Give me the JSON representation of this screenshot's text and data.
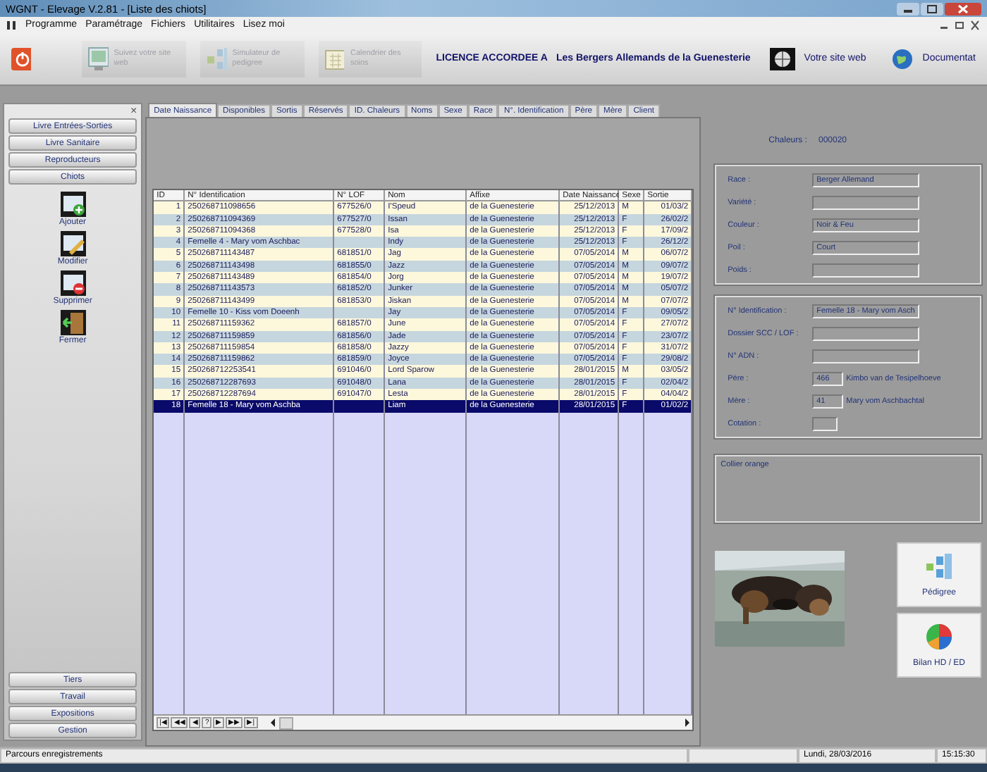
{
  "window": {
    "title": "WGNT - Elevage V.2.81 - [Liste des chiots]"
  },
  "menu": [
    "Programme",
    "Paramétrage",
    "Fichiers",
    "Utilitaires",
    "Lisez moi"
  ],
  "toolbar": {
    "buttons": [
      {
        "kind": "power"
      },
      {
        "kind": "web",
        "label": "Suivez votre site web",
        "disabled": true
      },
      {
        "kind": "pedigree",
        "label": "Simulateur de pedigree",
        "disabled": true
      },
      {
        "kind": "calendar",
        "label": "Calendrier des soins",
        "disabled": true
      }
    ],
    "licence": {
      "label": "LICENCE ACCORDEE A",
      "holder": "Les Bergers Allemands de la Guenesterie"
    },
    "links": [
      {
        "kind": "site",
        "label": "Votre site web"
      },
      {
        "kind": "doc",
        "label": "Documentat"
      }
    ]
  },
  "sidebar": {
    "close": "×",
    "top_sections": [
      "Livre Entrées-Sorties",
      "Livre Sanitaire",
      "Reproducteurs",
      "Chiots"
    ],
    "actions": [
      {
        "kind": "add",
        "label": "Ajouter"
      },
      {
        "kind": "edit",
        "label": "Modifier"
      },
      {
        "kind": "delete",
        "label": "Supprimer"
      },
      {
        "kind": "close",
        "label": "Fermer"
      }
    ],
    "bottom_sections": [
      "Tiers",
      "Travail",
      "Expositions",
      "Gestion"
    ]
  },
  "tabs": [
    {
      "label": "Date Naissance",
      "selected": true
    },
    {
      "label": "Disponibles",
      "selected": false
    },
    {
      "label": "Sortis",
      "selected": false
    },
    {
      "label": "Réservés",
      "selected": false
    },
    {
      "label": "ID. Chaleurs",
      "selected": false
    },
    {
      "label": "Noms",
      "selected": false
    },
    {
      "label": "Sexe",
      "selected": false
    },
    {
      "label": "Race",
      "selected": false
    },
    {
      "label": "N°. Identification",
      "selected": false
    },
    {
      "label": "Père",
      "selected": false
    },
    {
      "label": "Mère",
      "selected": false
    },
    {
      "label": "Client",
      "selected": false
    }
  ],
  "table": {
    "columns": [
      "ID",
      "N° Identification",
      "N° LOF",
      "Nom",
      "Affixe",
      "Date Naissance",
      "Sexe",
      "Sortie"
    ],
    "rows": [
      {
        "cells": [
          "1",
          "250268711098656",
          "677526/0",
          "I'Speud",
          "de la Guenesterie",
          "25/12/2013",
          "M",
          "01/03/2"
        ],
        "selected": false
      },
      {
        "cells": [
          "2",
          "250268711094369",
          "677527/0",
          "Issan",
          "de la Guenesterie",
          "25/12/2013",
          "F",
          "26/02/2"
        ],
        "selected": false
      },
      {
        "cells": [
          "3",
          "250268711094368",
          "677528/0",
          "Isa",
          "de la Guenesterie",
          "25/12/2013",
          "F",
          "17/09/2"
        ],
        "selected": false
      },
      {
        "cells": [
          "4",
          "Femelle 4 - Mary vom Aschbac",
          "",
          "Indy",
          "de la Guenesterie",
          "25/12/2013",
          "F",
          "26/12/2"
        ],
        "selected": false
      },
      {
        "cells": [
          "5",
          "250268711143487",
          "681851/0",
          "Jag",
          "de la Guenesterie",
          "07/05/2014",
          "M",
          "06/07/2"
        ],
        "selected": false
      },
      {
        "cells": [
          "6",
          "250268711143498",
          "681855/0",
          "Jazz",
          "de la Guenesterie",
          "07/05/2014",
          "M",
          "09/07/2"
        ],
        "selected": false
      },
      {
        "cells": [
          "7",
          "250268711143489",
          "681854/0",
          "Jorg",
          "de la Guenesterie",
          "07/05/2014",
          "M",
          "19/07/2"
        ],
        "selected": false
      },
      {
        "cells": [
          "8",
          "250268711143573",
          "681852/0",
          "Junker",
          "de la Guenesterie",
          "07/05/2014",
          "M",
          "05/07/2"
        ],
        "selected": false
      },
      {
        "cells": [
          "9",
          "250268711143499",
          "681853/0",
          "Jiskan",
          "de la Guenesterie",
          "07/05/2014",
          "M",
          "07/07/2"
        ],
        "selected": false
      },
      {
        "cells": [
          "10",
          "Femelle 10 - Kiss vom Doeenh",
          "",
          "Jay",
          "de la Guenesterie",
          "07/05/2014",
          "F",
          "09/05/2"
        ],
        "selected": false
      },
      {
        "cells": [
          "11",
          "250268711159362",
          "681857/0",
          "June",
          "de la Guenesterie",
          "07/05/2014",
          "F",
          "27/07/2"
        ],
        "selected": false
      },
      {
        "cells": [
          "12",
          "250268711159859",
          "681856/0",
          "Jade",
          "de la Guenesterie",
          "07/05/2014",
          "F",
          "23/07/2"
        ],
        "selected": false
      },
      {
        "cells": [
          "13",
          "250268711159854",
          "681858/0",
          "Jazzy",
          "de la Guenesterie",
          "07/05/2014",
          "F",
          "31/07/2"
        ],
        "selected": false
      },
      {
        "cells": [
          "14",
          "250268711159862",
          "681859/0",
          "Joyce",
          "de la Guenesterie",
          "07/05/2014",
          "F",
          "29/08/2"
        ],
        "selected": false
      },
      {
        "cells": [
          "15",
          "250268712253541",
          "691046/0",
          "Lord Sparow",
          "de la Guenesterie",
          "28/01/2015",
          "M",
          "03/05/2"
        ],
        "selected": false
      },
      {
        "cells": [
          "16",
          "250268712287693",
          "691048/0",
          "Lana",
          "de la Guenesterie",
          "28/01/2015",
          "F",
          "02/04/2"
        ],
        "selected": false
      },
      {
        "cells": [
          "17",
          "250268712287694",
          "691047/0",
          "Lesta",
          "de la Guenesterie",
          "28/01/2015",
          "F",
          "04/04/2"
        ],
        "selected": false
      },
      {
        "cells": [
          "18",
          "Femelle 18 - Mary vom Aschba",
          "",
          "Liam",
          "de la Guenesterie",
          "28/01/2015",
          "F",
          "01/02/2"
        ],
        "selected": true
      }
    ],
    "nav": [
      "|◀",
      "◀◀",
      "◀",
      "?",
      "▶",
      "▶▶",
      "▶|"
    ]
  },
  "details": {
    "chaleurs": {
      "label": "Chaleurs :",
      "value": "000020"
    },
    "group1": [
      {
        "label": "Race :",
        "value": "Berger Allemand"
      },
      {
        "label": "Variété :"
      },
      {
        "label": "Couleur :",
        "value": "Noir & Feu"
      },
      {
        "label": "Poil :",
        "value": "Court"
      },
      {
        "label": "Poids :"
      }
    ],
    "group2": [
      {
        "kind": "field",
        "label": "N° Identification :",
        "value": "Femelle 18 - Mary vom Asch"
      },
      {
        "kind": "field",
        "label": "Dossier SCC / LOF :"
      },
      {
        "kind": "field",
        "label": "N° ADN :"
      },
      {
        "kind": "parent",
        "label": "Père :",
        "value": "466",
        "name": "Kimbo van de Tesipelhoeve"
      },
      {
        "kind": "parent",
        "label": "Mère :",
        "value": "41",
        "name": "Mary vom Aschbachtal"
      },
      {
        "kind": "small",
        "label": "Cotation :"
      }
    ],
    "notes": "Collier orange",
    "buttons": [
      {
        "kind": "pedigree",
        "label": "Pédigree"
      },
      {
        "kind": "chart",
        "label": "Bilan HD / ED"
      }
    ]
  },
  "status_bar": [
    "Parcours enregistrements",
    "Lundi, 28/03/2016",
    "15:15:30"
  ]
}
